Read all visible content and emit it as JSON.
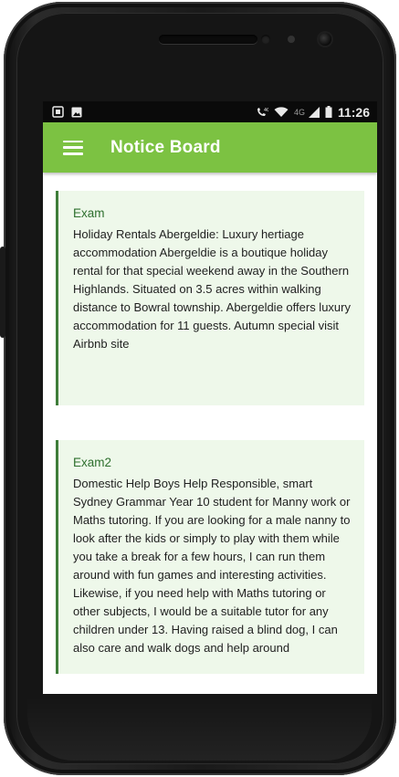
{
  "status_bar": {
    "time": "11:26",
    "network": "4G",
    "icons": [
      "screenshot-icon",
      "image-icon",
      "call-volte-icon",
      "wifi-icon",
      "signal-icon",
      "battery-icon"
    ]
  },
  "app_bar": {
    "title": "Notice Board",
    "background": "#7cc242",
    "menu_icon": "hamburger-menu-icon"
  },
  "notices": [
    {
      "title": "Exam",
      "body": "Holiday Rentals Abergeldie: Luxury hertiage accommodation Abergeldie is a boutique holiday rental for that special weekend away in the Southern Highlands. Situated on 3.5 acres within walking distance to Bowral township. Abergeldie offers luxury accommodation for 11 guests. Autumn special visit Airbnb site"
    },
    {
      "title": "Exam2",
      "body": "Domestic Help Boys Help Responsible, smart Sydney Grammar Year 10 student for Manny work or Maths tutoring. If you are looking for a male nanny to look after the kids or simply to play with them while you take a break for a few hours, I can run them around with fun games and interesting activities. Likewise, if you need help with Maths tutoring or other subjects, I would be a suitable tutor for any children under 13. Having raised a blind dog, I can also care and walk dogs and help around"
    }
  ],
  "colors": {
    "accent": "#7cc242",
    "card_background": "#eef8ea",
    "card_border": "#3f7d3a",
    "card_title": "#2e6f2e"
  }
}
